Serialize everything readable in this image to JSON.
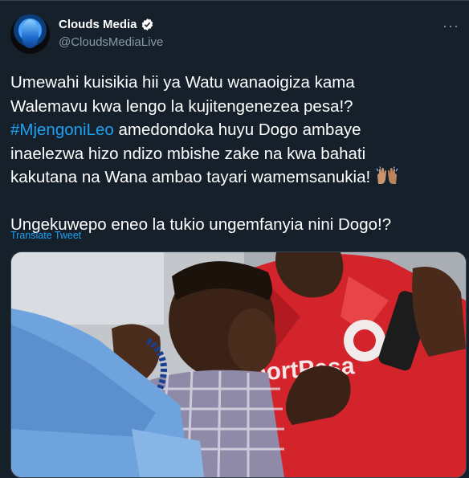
{
  "tweet": {
    "display_name": "Clouds Media",
    "handle": "@CloudsMediaLive",
    "more_label": "···",
    "text_line1": "Umewahi kuisikia hii ya Watu wanaoigiza kama",
    "text_line2": "Walemavu kwa lengo la kujitengenezea pesa!?",
    "hashtag": "#MjengoniLeo",
    "text_line3_rest": " amedondoka huyu Dogo ambaye",
    "text_line4": "inaelezwa hizo ndizo mbishe zake na kwa bahati",
    "text_line5": "kakutana na Wana ambao tayari wamemsanukia!",
    "text_line6": "Ungekuwepo eneo la tukio ungemfanyia nini Dogo!?",
    "translate_label": "Translate Tweet"
  },
  "icons": {
    "verified": "verified-badge-icon",
    "more": "more-options-icon",
    "clap": "raised-hands-emoji"
  },
  "colors": {
    "background": "#15202b",
    "link": "#1da1f2",
    "muted": "#8899a6"
  }
}
